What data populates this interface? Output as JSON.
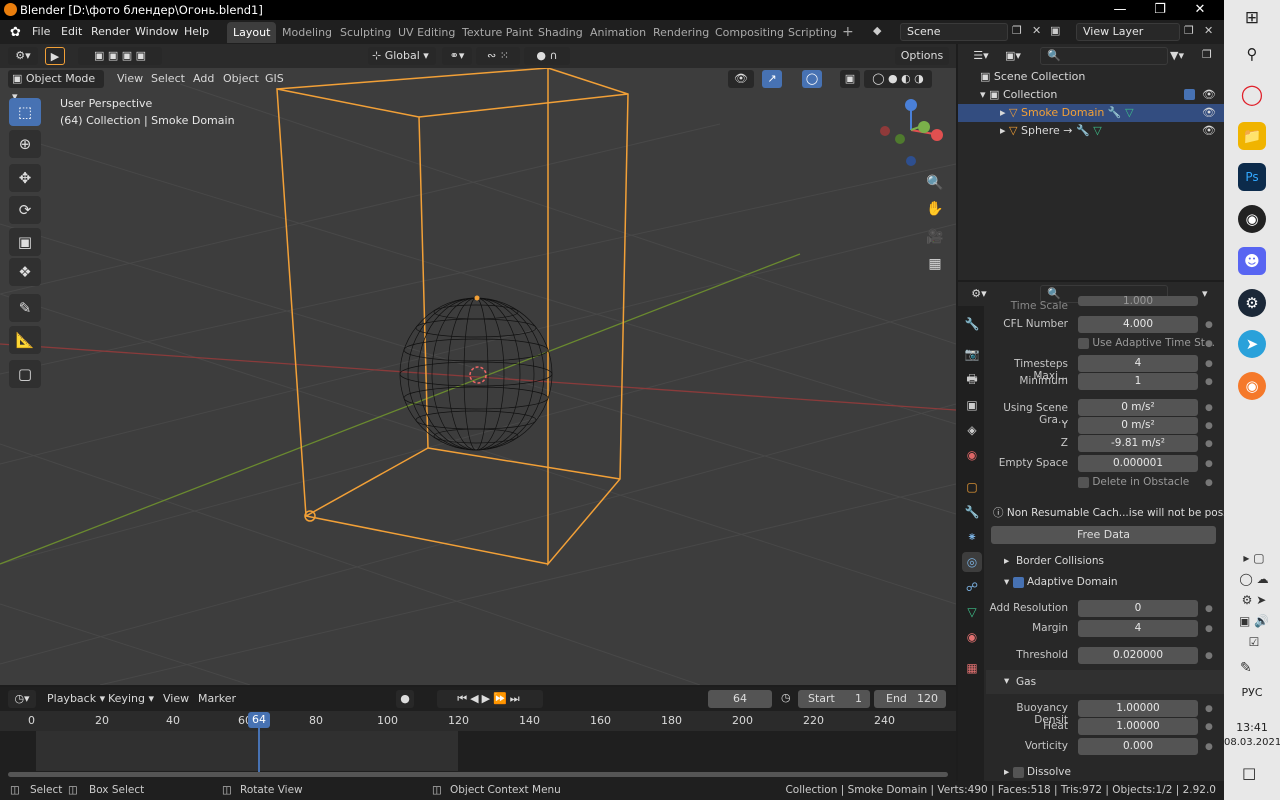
{
  "window": {
    "title": "Blender [D:\\фото блендер\\Огонь.blend1]"
  },
  "menu": [
    "File",
    "Edit",
    "Render",
    "Window",
    "Help"
  ],
  "workspaces": [
    "Layout",
    "Modeling",
    "Sculpting",
    "UV Editing",
    "Texture Paint",
    "Shading",
    "Animation",
    "Rendering",
    "Compositing",
    "Scripting"
  ],
  "scene": "Scene",
  "view_layer": "View Layer",
  "header": {
    "orientation": "Global",
    "options": "Options",
    "mode": "Object Mode",
    "view": "View",
    "select": "Select",
    "add": "Add",
    "object": "Object",
    "gis": "GIS"
  },
  "viewport": {
    "line1": "User Perspective",
    "line2": "(64) Collection | Smoke Domain"
  },
  "outliner": {
    "scene_collection": "Scene Collection",
    "collection": "Collection",
    "items": [
      "Smoke Domain",
      "Sphere"
    ]
  },
  "properties": {
    "time_scale": {
      "label": "Time Scale",
      "value": "1.000"
    },
    "cfl": {
      "label": "CFL Number",
      "value": "4.000"
    },
    "adaptive_time": "Use Adaptive Time St...",
    "timesteps_max": {
      "label": "Timesteps Maxi...",
      "value": "4"
    },
    "minimum": {
      "label": "Minimum",
      "value": "1"
    },
    "gravity_x": {
      "label": "Using Scene Gra...",
      "value": "0 m/s²"
    },
    "gravity_y": {
      "label": "Y",
      "value": "0 m/s²"
    },
    "gravity_z": {
      "label": "Z",
      "value": "-9.81 m/s²"
    },
    "empty_space": {
      "label": "Empty Space",
      "value": "0.000001"
    },
    "delete_obstacle": "Delete in Obstacle",
    "warning": "Non Resumable Cach...ise will not be possible",
    "free_data": "Free Data",
    "border": "Border Collisions",
    "adaptive_domain": "Adaptive Domain",
    "add_res": {
      "label": "Add Resolution",
      "value": "0"
    },
    "margin": {
      "label": "Margin",
      "value": "4"
    },
    "threshold": {
      "label": "Threshold",
      "value": "0.020000"
    },
    "gas": "Gas",
    "buoyancy": {
      "label": "Buoyancy Densit",
      "value": "1.00000"
    },
    "heat": {
      "label": "Heat",
      "value": "1.00000"
    },
    "vorticity": {
      "label": "Vorticity",
      "value": "0.000"
    },
    "dissolve": "Dissolve"
  },
  "timeline": {
    "playback": "Playback",
    "keying": "Keying",
    "view": "View",
    "marker": "Marker",
    "frame": "64",
    "start_label": "Start",
    "start": "1",
    "end_label": "End",
    "end": "120",
    "ticks": [
      "0",
      "20",
      "40",
      "60",
      "80",
      "100",
      "120",
      "140",
      "160",
      "180",
      "200",
      "220",
      "240"
    ]
  },
  "status": {
    "select": "Select",
    "box": "Box Select",
    "rotate": "Rotate View",
    "context": "Object Context Menu",
    "info": "Collection | Smoke Domain | Verts:490 | Faces:518 | Tris:972 | Objects:1/2 | 2.92.0"
  },
  "taskbar": {
    "lang": "РУС",
    "time": "13:41",
    "date": "08.03.2021"
  },
  "colors": {
    "accent": "#4772b3",
    "selection": "#f2a037",
    "bg": "#3d3d3d"
  }
}
